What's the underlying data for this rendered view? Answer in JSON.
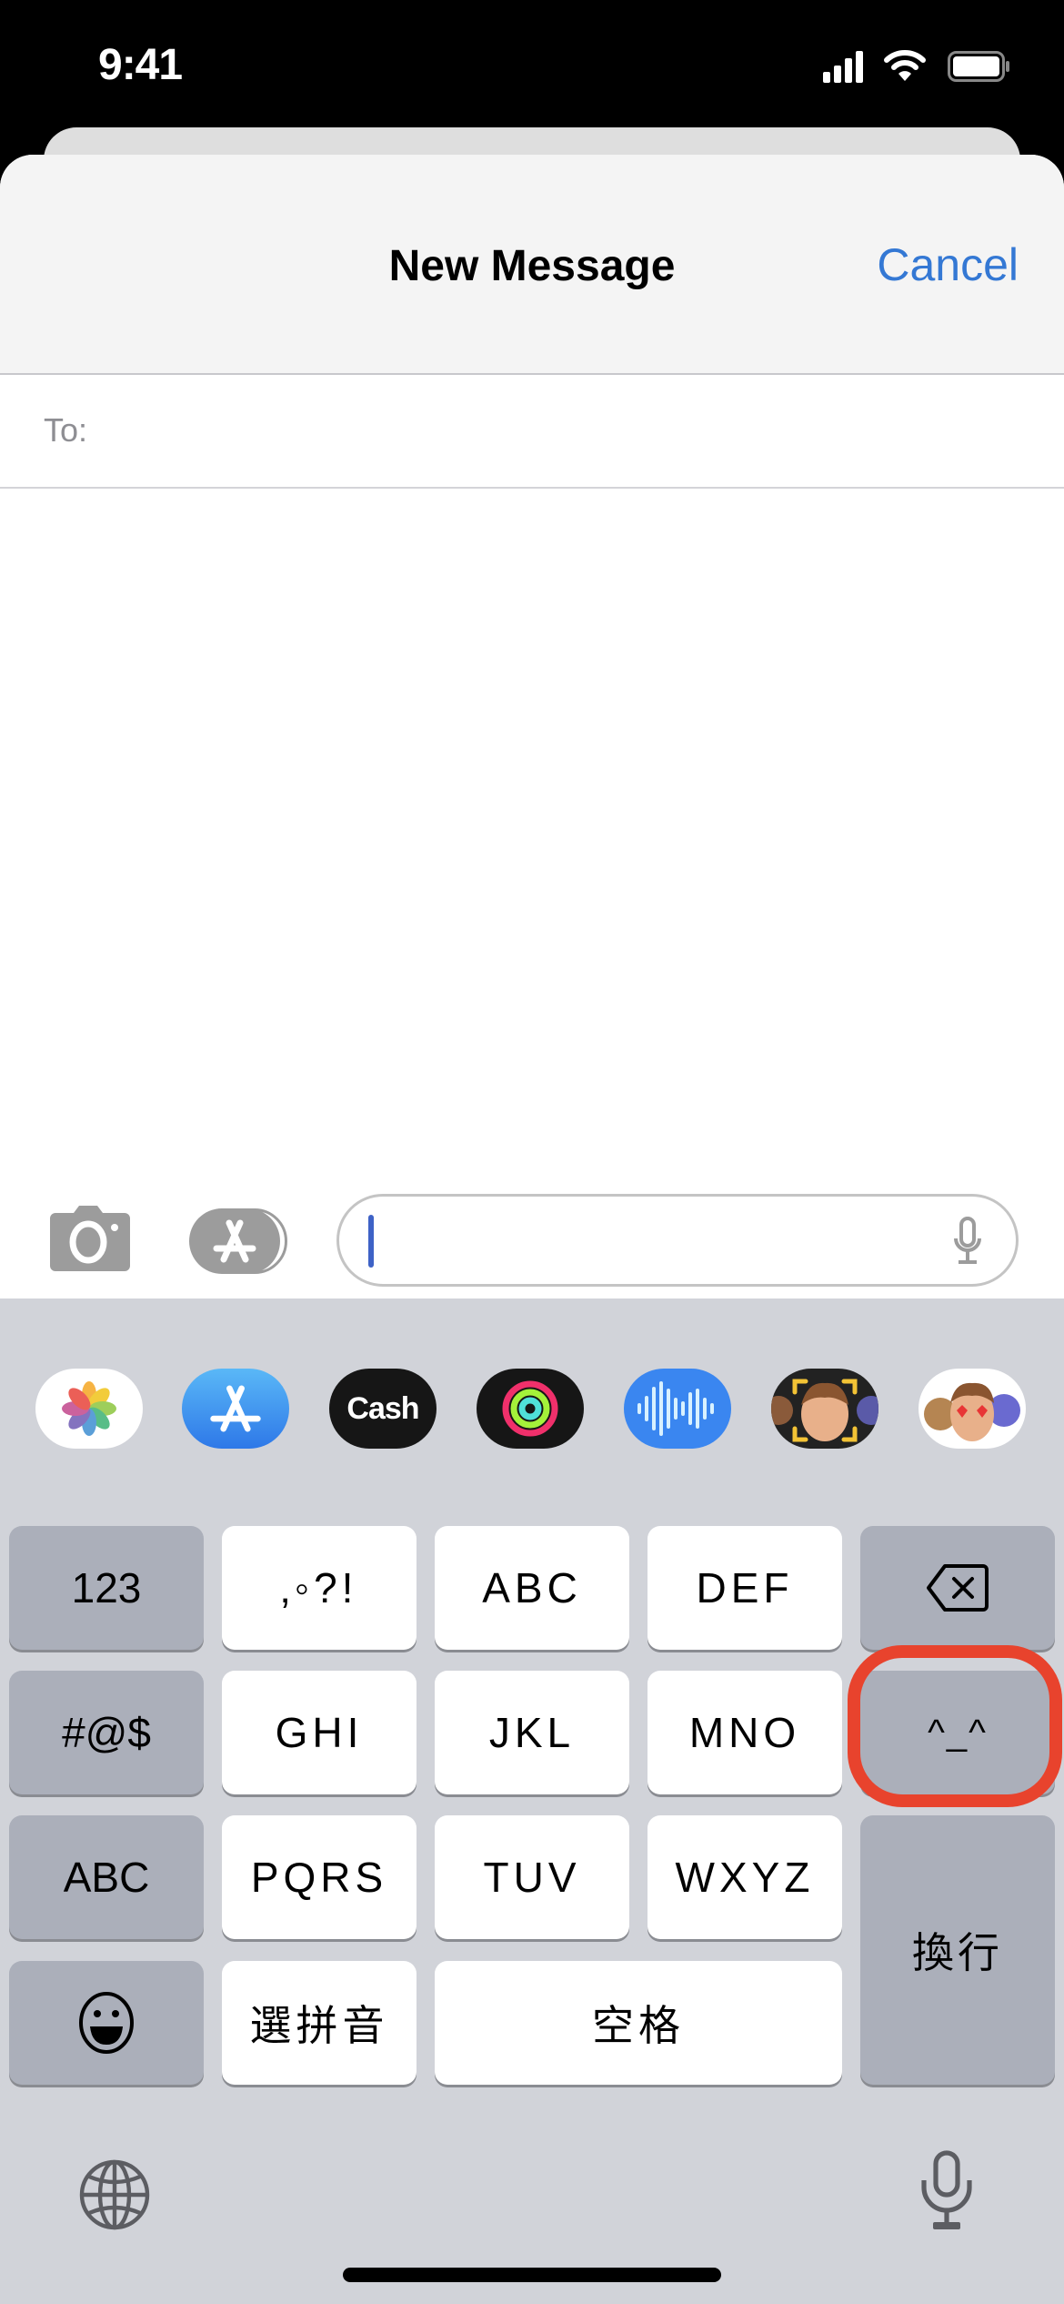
{
  "status_bar": {
    "time": "9:41",
    "icons": [
      "cellular-signal-icon",
      "wifi-icon",
      "battery-icon"
    ]
  },
  "nav": {
    "title": "New Message",
    "cancel_label": "Cancel"
  },
  "to_field": {
    "label": "To:",
    "value": ""
  },
  "compose": {
    "camera_icon": "camera-icon",
    "apps_icon": "app-store-icon",
    "message_value": "",
    "dictation_icon": "microphone-icon"
  },
  "app_drawer": [
    {
      "name": "Photos",
      "icon": "photos-icon"
    },
    {
      "name": "App Store",
      "icon": "app-store-icon"
    },
    {
      "name": "Apple Cash",
      "label": "Cash",
      "icon": "apple-cash-icon"
    },
    {
      "name": "Activity",
      "icon": "activity-rings-icon"
    },
    {
      "name": "Audio",
      "icon": "audio-waveform-icon"
    },
    {
      "name": "Memoji",
      "icon": "memoji-camera-icon"
    },
    {
      "name": "Memoji Stickers",
      "icon": "memoji-stickers-icon"
    }
  ],
  "keyboard": {
    "rows": [
      [
        "123",
        "，。?!",
        "ABC",
        "DEF",
        "⌫"
      ],
      [
        "#@$",
        "GHI",
        "JKL",
        "MNO",
        "^_^"
      ],
      [
        "ABC",
        "PQRS",
        "TUV",
        "WXYZ",
        "換行"
      ],
      [
        "☺",
        "選拼音",
        "空格"
      ]
    ],
    "key_123": "123",
    "key_punct": "‚◦?!",
    "key_abc": "ABC",
    "key_def": "DEF",
    "key_symbols": "#@$",
    "key_ghi": "GHI",
    "key_jkl": "JKL",
    "key_mno": "MNO",
    "key_emoticon": "^_^",
    "key_abc_switch": "ABC",
    "key_pqrs": "PQRS",
    "key_tuv": "TUV",
    "key_wxyz": "WXYZ",
    "key_return": "換行",
    "key_pinyin": "選拼音",
    "key_space": "空格",
    "highlighted_key": "^_^"
  },
  "colors": {
    "accent": "#3478d4",
    "highlight": "#e8432d",
    "keyboard_bg": "#d1d3d9"
  }
}
